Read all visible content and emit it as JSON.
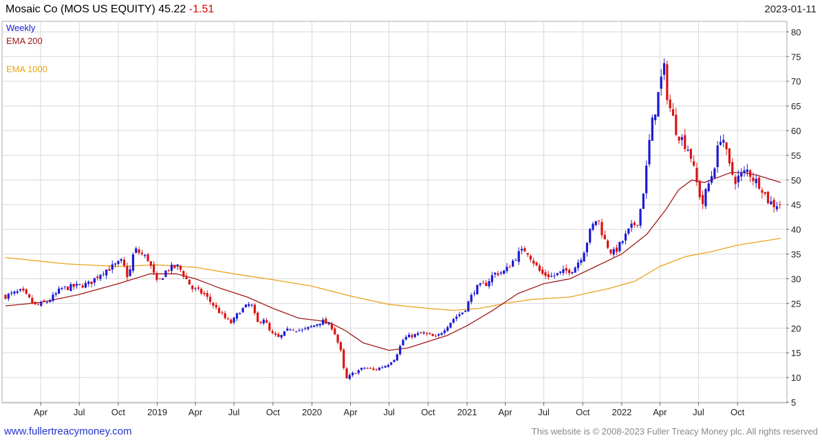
{
  "header": {
    "name": "Mosaic Co (MOS US EQUITY)",
    "last": "45.22",
    "change": "-1.51",
    "date": "2023-01-11"
  },
  "footer": {
    "link": "www.fullertreacymoney.com",
    "copyright": "This website is © 2008-2023 Fuller Treacy Money plc. All rights reserved"
  },
  "colors": {
    "up": "#1a1ad4",
    "down": "#dd1111",
    "ema200": "#a01818",
    "ema1000": "#e8a21a",
    "grid": "#d8d8d8",
    "weekly_label": "#1a1ad4"
  },
  "chart_data": {
    "type": "candlestick",
    "frequency": "Weekly",
    "legend": [
      "Weekly",
      "EMA 200",
      "EMA 1000"
    ],
    "legend_position": "top-left",
    "grid": true,
    "y_axis": {
      "position": "right",
      "ylim": [
        5,
        82
      ],
      "ticks": [
        5,
        10,
        15,
        20,
        25,
        30,
        35,
        40,
        45,
        50,
        55,
        60,
        65,
        70,
        75,
        80
      ]
    },
    "x_axis": {
      "range": [
        "2018-01-08",
        "2023-01-11"
      ],
      "tick_labels": [
        {
          "label": "Apr",
          "date": "2018-04-01"
        },
        {
          "label": "Jul",
          "date": "2018-07-01"
        },
        {
          "label": "Oct",
          "date": "2018-10-01"
        },
        {
          "label": "2019",
          "date": "2019-01-01"
        },
        {
          "label": "Apr",
          "date": "2019-04-01"
        },
        {
          "label": "Jul",
          "date": "2019-07-01"
        },
        {
          "label": "Oct",
          "date": "2019-10-01"
        },
        {
          "label": "2020",
          "date": "2020-01-01"
        },
        {
          "label": "Apr",
          "date": "2020-04-01"
        },
        {
          "label": "Jul",
          "date": "2020-07-01"
        },
        {
          "label": "Oct",
          "date": "2020-10-01"
        },
        {
          "label": "2021",
          "date": "2021-01-01"
        },
        {
          "label": "Apr",
          "date": "2021-04-01"
        },
        {
          "label": "Jul",
          "date": "2021-07-01"
        },
        {
          "label": "Oct",
          "date": "2021-10-01"
        },
        {
          "label": "2022",
          "date": "2022-01-01"
        },
        {
          "label": "Apr",
          "date": "2022-04-01"
        },
        {
          "label": "Jul",
          "date": "2022-07-01"
        },
        {
          "label": "Oct",
          "date": "2022-10-01"
        }
      ]
    },
    "close_path": [
      [
        "2018-01-08",
        26.5
      ],
      [
        "2018-02-15",
        27.5
      ],
      [
        "2018-03-20",
        24.5
      ],
      [
        "2018-04-20",
        25.5
      ],
      [
        "2018-05-20",
        28.0
      ],
      [
        "2018-06-25",
        28.5
      ],
      [
        "2018-07-25",
        29.0
      ],
      [
        "2018-08-25",
        31.5
      ],
      [
        "2018-09-20",
        32.5
      ],
      [
        "2018-10-10",
        33.5
      ],
      [
        "2018-10-25",
        30.0
      ],
      [
        "2018-11-08",
        36.0
      ],
      [
        "2018-12-10",
        34.0
      ],
      [
        "2019-01-01",
        29.0
      ],
      [
        "2019-01-25",
        32.0
      ],
      [
        "2019-02-20",
        32.5
      ],
      [
        "2019-03-10",
        30.0
      ],
      [
        "2019-03-25",
        28.0
      ],
      [
        "2019-04-20",
        27.0
      ],
      [
        "2019-05-20",
        24.0
      ],
      [
        "2019-06-10",
        22.0
      ],
      [
        "2019-06-25",
        21.0
      ],
      [
        "2019-07-15",
        23.5
      ],
      [
        "2019-08-10",
        25.0
      ],
      [
        "2019-08-25",
        21.0
      ],
      [
        "2019-09-10",
        22.0
      ],
      [
        "2019-09-25",
        19.0
      ],
      [
        "2019-10-15",
        18.0
      ],
      [
        "2019-11-10",
        20.0
      ],
      [
        "2019-12-10",
        19.5
      ],
      [
        "2020-01-05",
        20.5
      ],
      [
        "2020-01-25",
        21.5
      ],
      [
        "2020-02-20",
        20.0
      ],
      [
        "2020-03-10",
        15.0
      ],
      [
        "2020-03-20",
        9.5
      ],
      [
        "2020-04-10",
        11.0
      ],
      [
        "2020-05-05",
        12.0
      ],
      [
        "2020-05-25",
        11.5
      ],
      [
        "2020-06-25",
        12.5
      ],
      [
        "2020-07-15",
        14.0
      ],
      [
        "2020-08-05",
        18.0
      ],
      [
        "2020-08-25",
        18.5
      ],
      [
        "2020-09-20",
        19.0
      ],
      [
        "2020-10-20",
        18.0
      ],
      [
        "2020-11-10",
        20.0
      ],
      [
        "2020-12-01",
        22.0
      ],
      [
        "2020-12-25",
        23.5
      ],
      [
        "2021-01-20",
        28.0
      ],
      [
        "2021-02-15",
        29.0
      ],
      [
        "2021-03-05",
        31.0
      ],
      [
        "2021-04-01",
        31.5
      ],
      [
        "2021-05-01",
        35.0
      ],
      [
        "2021-05-20",
        36.0
      ],
      [
        "2021-06-10",
        33.0
      ],
      [
        "2021-06-25",
        31.0
      ],
      [
        "2021-07-20",
        30.5
      ],
      [
        "2021-08-20",
        31.5
      ],
      [
        "2021-09-10",
        32.0
      ],
      [
        "2021-10-01",
        35.0
      ],
      [
        "2021-10-20",
        40.0
      ],
      [
        "2021-11-05",
        42.5
      ],
      [
        "2021-11-20",
        38.0
      ],
      [
        "2021-12-10",
        35.0
      ],
      [
        "2021-12-25",
        36.5
      ],
      [
        "2022-01-20",
        40.0
      ],
      [
        "2022-02-10",
        42.0
      ],
      [
        "2022-02-25",
        50.0
      ],
      [
        "2022-03-10",
        60.0
      ],
      [
        "2022-03-25",
        66.0
      ],
      [
        "2022-04-10",
        73.0
      ],
      [
        "2022-04-20",
        66.0
      ],
      [
        "2022-05-10",
        60.0
      ],
      [
        "2022-05-25",
        58.0
      ],
      [
        "2022-06-10",
        56.0
      ],
      [
        "2022-06-25",
        50.0
      ],
      [
        "2022-07-10",
        45.0
      ],
      [
        "2022-07-20",
        48.0
      ],
      [
        "2022-08-05",
        52.0
      ],
      [
        "2022-08-25",
        60.0
      ],
      [
        "2022-09-10",
        53.0
      ],
      [
        "2022-09-25",
        50.0
      ],
      [
        "2022-10-10",
        51.0
      ],
      [
        "2022-10-25",
        52.0
      ],
      [
        "2022-11-10",
        50.0
      ],
      [
        "2022-11-25",
        49.0
      ],
      [
        "2022-12-10",
        46.0
      ],
      [
        "2022-12-25",
        45.0
      ],
      [
        "2023-01-11",
        45.22
      ]
    ],
    "ema200": [
      [
        "2018-01-08",
        24.5
      ],
      [
        "2018-04-01",
        25.2
      ],
      [
        "2018-07-01",
        26.8
      ],
      [
        "2018-10-01",
        29.0
      ],
      [
        "2018-12-15",
        31.0
      ],
      [
        "2019-02-15",
        31.0
      ],
      [
        "2019-04-01",
        30.0
      ],
      [
        "2019-06-01",
        28.0
      ],
      [
        "2019-08-01",
        26.3
      ],
      [
        "2019-10-01",
        24.0
      ],
      [
        "2019-12-01",
        22.0
      ],
      [
        "2020-01-20",
        21.5
      ],
      [
        "2020-02-15",
        21.0
      ],
      [
        "2020-03-20",
        19.5
      ],
      [
        "2020-05-01",
        17.0
      ],
      [
        "2020-07-01",
        15.5
      ],
      [
        "2020-08-15",
        16.0
      ],
      [
        "2020-10-01",
        17.3
      ],
      [
        "2020-11-15",
        18.5
      ],
      [
        "2021-01-01",
        20.5
      ],
      [
        "2021-03-01",
        23.5
      ],
      [
        "2021-05-01",
        27.0
      ],
      [
        "2021-07-01",
        29.0
      ],
      [
        "2021-09-01",
        30.0
      ],
      [
        "2021-11-01",
        32.5
      ],
      [
        "2022-01-01",
        35.0
      ],
      [
        "2022-03-01",
        39.0
      ],
      [
        "2022-04-15",
        44.0
      ],
      [
        "2022-05-15",
        48.0
      ],
      [
        "2022-06-15",
        50.0
      ],
      [
        "2022-07-15",
        49.5
      ],
      [
        "2022-08-15",
        50.5
      ],
      [
        "2022-09-15",
        51.5
      ],
      [
        "2022-10-15",
        51.5
      ],
      [
        "2022-11-15",
        51.0
      ],
      [
        "2023-01-11",
        49.5
      ]
    ],
    "ema1000": [
      [
        "2018-01-08",
        34.3
      ],
      [
        "2018-06-01",
        33.0
      ],
      [
        "2018-10-01",
        32.5
      ],
      [
        "2019-01-01",
        32.8
      ],
      [
        "2019-04-01",
        32.3
      ],
      [
        "2019-07-01",
        31.0
      ],
      [
        "2019-10-01",
        29.8
      ],
      [
        "2020-01-01",
        28.5
      ],
      [
        "2020-04-01",
        26.5
      ],
      [
        "2020-07-01",
        24.8
      ],
      [
        "2020-10-01",
        24.0
      ],
      [
        "2020-12-01",
        23.6
      ],
      [
        "2021-02-01",
        24.0
      ],
      [
        "2021-04-01",
        25.0
      ],
      [
        "2021-06-01",
        25.8
      ],
      [
        "2021-09-01",
        26.3
      ],
      [
        "2021-12-01",
        28.0
      ],
      [
        "2022-02-01",
        29.5
      ],
      [
        "2022-04-01",
        32.5
      ],
      [
        "2022-06-01",
        34.5
      ],
      [
        "2022-08-01",
        35.5
      ],
      [
        "2022-10-01",
        36.8
      ],
      [
        "2023-01-11",
        38.2
      ]
    ]
  }
}
